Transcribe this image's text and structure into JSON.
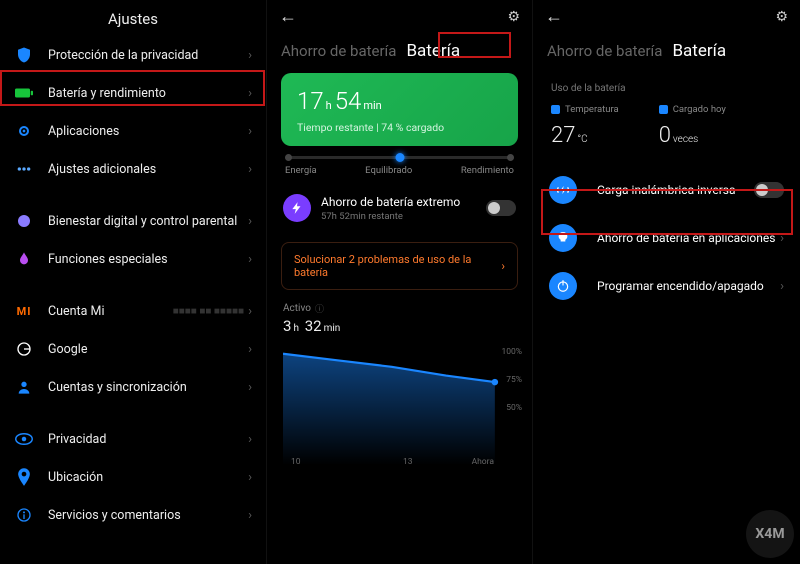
{
  "pane1": {
    "title": "Ajustes",
    "items": [
      {
        "icon": "shield-icon",
        "color": "#1a86ff",
        "label": "Protección de la privacidad"
      },
      {
        "icon": "battery-icon",
        "color": "#17c43b",
        "label": "Batería y rendimiento",
        "highlight": true
      },
      {
        "icon": "apps-icon",
        "color": "#1a86ff",
        "label": "Aplicaciones"
      },
      {
        "icon": "more-icon",
        "color": "#5aa9ff",
        "label": "Ajustes adicionales"
      }
    ],
    "items2": [
      {
        "icon": "wellbeing-icon",
        "color": "#8a7bff",
        "label": "Bienestar digital y control parental"
      },
      {
        "icon": "special-icon",
        "color": "#b94df0",
        "label": "Funciones especiales"
      }
    ],
    "items3": [
      {
        "icon": "mi",
        "label": "Cuenta Mi",
        "account": "■■■■ ■■ ■■■■■"
      },
      {
        "icon": "google-icon",
        "color": "#fff",
        "label": "Google"
      },
      {
        "icon": "sync-icon",
        "color": "#1a86ff",
        "label": "Cuentas y sincronización"
      }
    ],
    "items4": [
      {
        "icon": "eye-icon",
        "color": "#1a86ff",
        "label": "Privacidad"
      },
      {
        "icon": "location-icon",
        "color": "#1a86ff",
        "label": "Ubicación"
      },
      {
        "icon": "feedback-icon",
        "color": "#1a86ff",
        "label": "Servicios y comentarios"
      }
    ]
  },
  "pane2": {
    "tab_inactive": "Ahorro de batería",
    "tab_active": "Batería",
    "battery": {
      "hours": "17",
      "h_unit": "h",
      "mins": "54",
      "m_unit": "min",
      "subtitle": "Tiempo restante | 74 % cargado"
    },
    "slider": {
      "l1": "Energía",
      "l2": "Equilibrado",
      "l3": "Rendimiento"
    },
    "extreme": {
      "title": "Ahorro de batería extremo",
      "sub": "57h 52min restante"
    },
    "fix": "Solucionar 2 problemas de uso de la batería",
    "active_label": "Activo",
    "active_time": {
      "h": "3",
      "hu": "h",
      "m": "32",
      "mu": "min"
    },
    "ylabels": [
      "100%",
      "75%",
      "50%"
    ],
    "xlabels": [
      "10",
      "13",
      "Ahora"
    ]
  },
  "pane3": {
    "tab_inactive": "Ahorro de batería",
    "tab_active": "Batería",
    "usage_label": "Uso de la batería",
    "temp": {
      "label": "Temperatura",
      "value": "27",
      "unit": "°C"
    },
    "charged": {
      "label": "Cargado hoy",
      "value": "0",
      "unit": "veces"
    },
    "rows": [
      {
        "icon": "reverse-charge-icon",
        "label": "Carga inalámbrica inversa",
        "toggle": true,
        "highlight": true
      },
      {
        "icon": "bulb-icon",
        "label": "Ahorro de batería en aplicaciones",
        "chev": true
      },
      {
        "icon": "power-icon",
        "label": "Programar encendido/apagado",
        "chev": true
      }
    ]
  },
  "chart_data": {
    "type": "area",
    "title": "Activo",
    "x": [
      10,
      11,
      12,
      13,
      14
    ],
    "y": [
      100,
      94,
      89,
      82,
      76
    ],
    "xlabel_ticks": [
      "10",
      "13",
      "Ahora"
    ],
    "ylabel_ticks": [
      "100%",
      "75%",
      "50%"
    ],
    "ylim": [
      0,
      100
    ]
  }
}
